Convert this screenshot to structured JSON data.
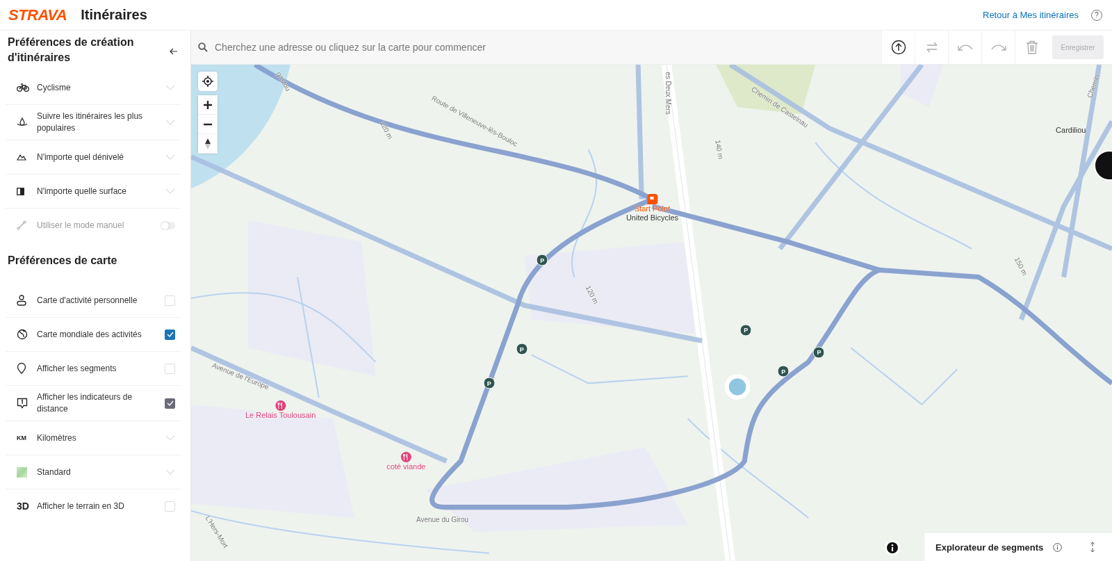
{
  "header": {
    "logo": "STRAVA",
    "title": "Itinéraires",
    "back_link": "Retour à Mes itinéraires",
    "help": "?"
  },
  "sidebar": {
    "title": "Préférences de création d'itinéraires",
    "route_preferences": [
      {
        "kind": "dropdown",
        "label": "Cyclisme"
      },
      {
        "kind": "dropdown",
        "label": "Suivre les itinéraires les plus populaires"
      },
      {
        "kind": "dropdown",
        "label": "N'importe quel dénivelé"
      },
      {
        "kind": "dropdown",
        "label": "N'importe quelle surface"
      },
      {
        "kind": "toggle",
        "label": "Utiliser le mode manuel",
        "on": false,
        "disabled": true
      }
    ],
    "map_title": "Préférences de carte",
    "map_preferences": [
      {
        "kind": "checkbox",
        "label": "Carte d'activité personnelle",
        "checked": false
      },
      {
        "kind": "checkbox",
        "label": "Carte mondiale des activités",
        "checked": true
      },
      {
        "kind": "checkbox",
        "label": "Afficher les segments",
        "checked": false
      },
      {
        "kind": "checkbox",
        "label": "Afficher les indicateurs de distance",
        "checked": true,
        "disabled": true
      },
      {
        "kind": "dropdown",
        "icon_text": "KM",
        "label": "Kilomètres"
      },
      {
        "kind": "dropdown",
        "label": "Standard"
      },
      {
        "kind": "checkbox",
        "icon_text": "3D",
        "label": "Afficher le terrain en 3D",
        "checked": false
      }
    ]
  },
  "toolbar": {
    "search_placeholder": "Cherchez une adresse ou cliquez sur la carte pour commencer",
    "tools": [
      {
        "kind": "upload",
        "disabled": false
      },
      {
        "kind": "swap",
        "disabled": true
      },
      {
        "kind": "undo",
        "disabled": true
      },
      {
        "kind": "redo",
        "disabled": true
      },
      {
        "kind": "delete",
        "disabled": true
      }
    ],
    "save": {
      "label": "Enregistrer",
      "disabled": true
    }
  },
  "map": {
    "pois": [
      {
        "kind": "start",
        "label": "Start Point",
        "sublabel": "United Bicycles"
      },
      {
        "kind": "restaurant",
        "label": "Le Relais Toulousain"
      },
      {
        "kind": "restaurant",
        "label": "coté viande"
      },
      {
        "kind": "place",
        "label": "Cardiliou"
      },
      {
        "kind": "parking",
        "label": "P"
      },
      {
        "kind": "parking",
        "label": "P"
      },
      {
        "kind": "parking",
        "label": "P"
      },
      {
        "kind": "parking",
        "label": "P"
      },
      {
        "kind": "parking",
        "label": "P"
      },
      {
        "kind": "parking",
        "label": "P"
      }
    ],
    "road_labels": [
      "gastou",
      "Route de Villeneuve-lès-Bouloc",
      "120 m",
      "es Deux Mers",
      "Chemin de Castelnau",
      "140 m",
      "120 m",
      "150 m",
      "Chemin",
      "Avenue de l'Europe",
      "Avenue du Girou",
      "L'Hers-Mort"
    ],
    "segment_explorer": {
      "title": "Explorateur de segments"
    }
  }
}
